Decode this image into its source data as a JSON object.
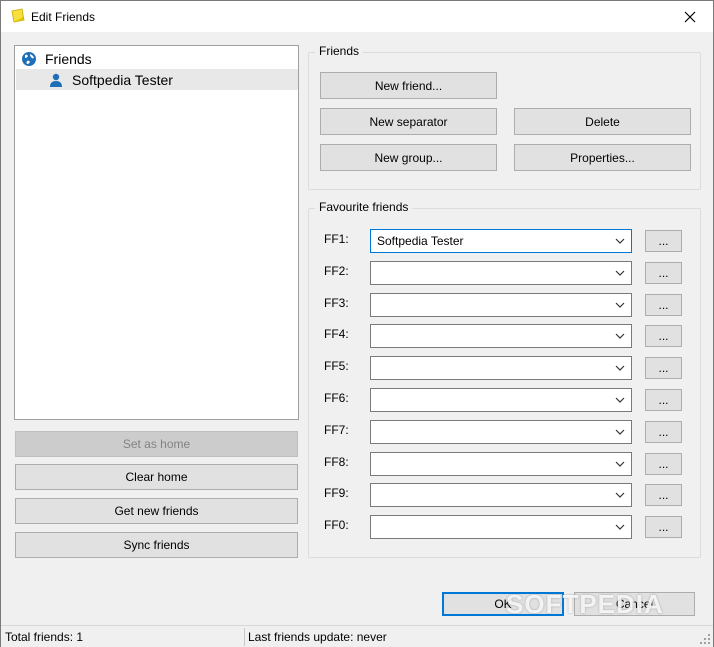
{
  "window": {
    "title": "Edit Friends"
  },
  "tree": {
    "root": {
      "label": "Friends",
      "icon": "globe-icon"
    },
    "children": [
      {
        "label": "Softpedia Tester",
        "icon": "person-icon"
      }
    ]
  },
  "left_buttons": {
    "set_home": "Set as home",
    "clear_home": "Clear home",
    "get_new": "Get new friends",
    "sync": "Sync friends"
  },
  "friends_group": {
    "label": "Friends",
    "new_friend": "New friend...",
    "new_separator": "New separator",
    "delete": "Delete",
    "new_group": "New group...",
    "properties": "Properties..."
  },
  "favourites": {
    "label": "Favourite friends",
    "button_label": "...",
    "slots": [
      {
        "label": "FF1:",
        "value": "Softpedia Tester"
      },
      {
        "label": "FF2:",
        "value": ""
      },
      {
        "label": "FF3:",
        "value": ""
      },
      {
        "label": "FF4:",
        "value": ""
      },
      {
        "label": "FF5:",
        "value": ""
      },
      {
        "label": "FF6:",
        "value": ""
      },
      {
        "label": "FF7:",
        "value": ""
      },
      {
        "label": "FF8:",
        "value": ""
      },
      {
        "label": "FF9:",
        "value": ""
      },
      {
        "label": "FF0:",
        "value": ""
      }
    ]
  },
  "dialog_buttons": {
    "ok": "OK",
    "cancel": "Cancel"
  },
  "status": {
    "total": "Total friends: 1",
    "last_update": "Last friends update: never"
  },
  "watermark": "SOFTPEDIA",
  "colors": {
    "accent": "#0078d7",
    "selection": "#e8e8e8",
    "globe": "#1e6fb8",
    "person": "#1e6fb8"
  }
}
